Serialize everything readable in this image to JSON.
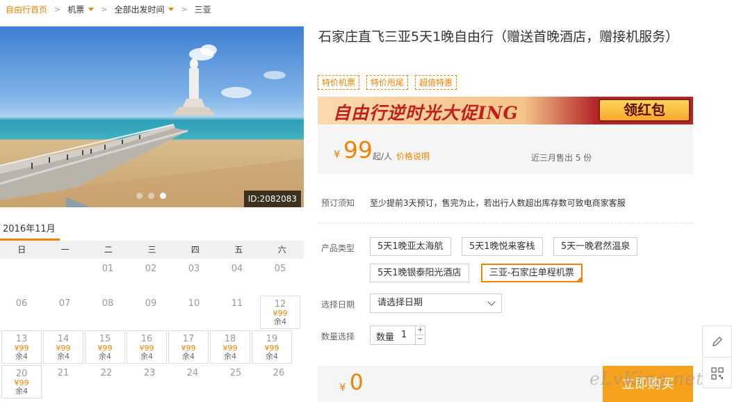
{
  "breadcrumb": {
    "home": "自由行首页",
    "items": [
      "机票",
      "全部出发时间",
      "三亚"
    ]
  },
  "gallery": {
    "id_label": "ID:2082083",
    "dots": 3,
    "active_dot": 2
  },
  "calendar": {
    "title": "2016年11月",
    "weekdays": [
      "日",
      "一",
      "二",
      "三",
      "四",
      "五",
      "六"
    ],
    "rows": [
      [
        {
          "d": ""
        },
        {
          "d": ""
        },
        {
          "d": "01"
        },
        {
          "d": "02"
        },
        {
          "d": "03"
        },
        {
          "d": "04"
        },
        {
          "d": "05"
        }
      ],
      [
        {
          "d": "06"
        },
        {
          "d": "07"
        },
        {
          "d": "08"
        },
        {
          "d": "09"
        },
        {
          "d": "10"
        },
        {
          "d": "11"
        },
        {
          "d": "12",
          "price": "¥99",
          "remain": "余4"
        }
      ],
      [
        {
          "d": "13",
          "price": "¥99",
          "remain": "余4"
        },
        {
          "d": "14",
          "price": "¥99",
          "remain": "余4"
        },
        {
          "d": "15",
          "price": "¥99",
          "remain": "余4"
        },
        {
          "d": "16",
          "price": "¥99",
          "remain": "余4"
        },
        {
          "d": "17",
          "price": "¥99",
          "remain": "余4"
        },
        {
          "d": "18",
          "price": "¥99",
          "remain": "余4"
        },
        {
          "d": "19",
          "price": "¥99",
          "remain": "余4"
        }
      ],
      [
        {
          "d": "20",
          "price": "¥99",
          "remain": "余4"
        },
        {
          "d": "21"
        },
        {
          "d": "22"
        },
        {
          "d": "23"
        },
        {
          "d": "24"
        },
        {
          "d": "25"
        },
        {
          "d": "26"
        }
      ]
    ]
  },
  "product": {
    "title": "石家庄直飞三亚5天1晚自由行（赠送首晚酒店，赠接机服务）",
    "tags": [
      "特价机票",
      "特价甩尾",
      "超值特惠"
    ]
  },
  "banner": {
    "text": "自由行逆时光大促ING",
    "button": "领红包"
  },
  "price": {
    "currency": "¥",
    "value": "99",
    "unit": "起/人",
    "explain": "价格说明",
    "sold": "近三月售出 5 份"
  },
  "booking": {
    "notice_label": "预订须知",
    "notice_text": "至少提前3天预订，售完为止，若出行人数超出库存数可致电商家客服",
    "type_label": "产品类型",
    "types": [
      "5天1晚亚太海航",
      "5天1晚悦来客栈",
      "5天一晚君然温泉",
      "5天1晚银泰阳光酒店",
      "三亚-石家庄单程机票"
    ],
    "selected_type": 4,
    "date_label": "选择日期",
    "date_value": "请选择日期",
    "qty_label": "数量选择",
    "qty_text": "数量",
    "qty_value": "1",
    "plus": "+",
    "minus": "−"
  },
  "total": {
    "currency": "¥",
    "value": "0"
  },
  "buy_button": "立即购买",
  "watermark": "eLvKing.net"
}
